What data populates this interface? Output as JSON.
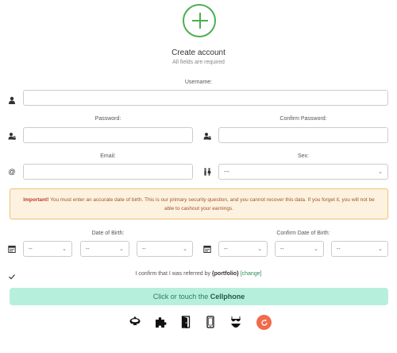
{
  "header": {
    "title": "Create account",
    "subtitle": "All fields are required"
  },
  "fields": {
    "username_label": "Username:",
    "password_label": "Password:",
    "confirm_password_label": "Confirm Password:",
    "email_label": "Email:",
    "sex_label": "Sex:",
    "sex_value": "---"
  },
  "alert": {
    "strong": "Important!",
    "text": " You must enter an accurate date of birth. This is our primary security question, and you cannot recover this data. If you forget it, you will not be able to cashout your earnings."
  },
  "dob": {
    "label": "Date of Birth:",
    "confirm_label": "Confirm Date of Birth:",
    "placeholder": "--"
  },
  "referral": {
    "prefix": "I confirm that I was referred by ",
    "referrer": "{portfolio}",
    "change": "[change]"
  },
  "captcha": {
    "prefix": "Click or touch the ",
    "target": "Cellphone",
    "icons": [
      "pot-icon",
      "puzzle-icon",
      "door-icon",
      "cellphone-icon",
      "bikini-icon"
    ]
  },
  "colors": {
    "accent": "#4caf50",
    "alert_bg": "#fcf2df",
    "alert_border": "#f0c070",
    "captcha_bg": "#b6f0dc",
    "refresh": "#f26a4b"
  }
}
